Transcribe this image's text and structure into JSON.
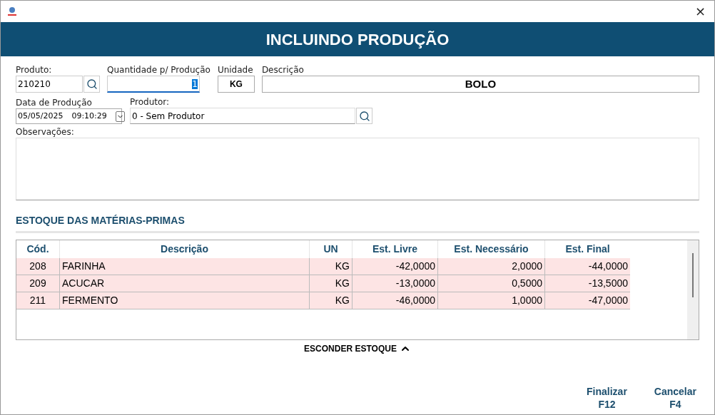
{
  "window": {
    "close": "×"
  },
  "header": {
    "title": "INCLUINDO PRODUÇÃO"
  },
  "form": {
    "produto": {
      "label": "Produto:",
      "value": "210210"
    },
    "quantidade": {
      "label": "Quantidade p/ Produção",
      "value": "1"
    },
    "unidade": {
      "label": "Unidade",
      "value": "KG"
    },
    "descricao": {
      "label": "Descrição",
      "value": "BOLO"
    },
    "data": {
      "label": "Data de Produção",
      "date": "05/05/2025",
      "time": "09:10:29"
    },
    "produtor": {
      "label": "Produtor:",
      "value": "0 - Sem Produtor"
    },
    "observacoes": {
      "label": "Observações:"
    }
  },
  "stock": {
    "title": "ESTOQUE DAS MATÉRIAS-PRIMAS",
    "table": {
      "columns": [
        "Cód.",
        "Descrição",
        "UN",
        "Est. Livre",
        "Est. Necessário",
        "Est. Final"
      ],
      "rows": [
        [
          "208",
          "FARINHA",
          "KG",
          "-42,0000",
          "2,0000",
          "-44,0000"
        ],
        [
          "209",
          "ACUCAR",
          "KG",
          "-13,0000",
          "0,5000",
          "-13,5000"
        ],
        [
          "211",
          "FERMENTO",
          "KG",
          "-46,0000",
          "1,0000",
          "-47,0000"
        ]
      ]
    },
    "toggle": "ESCONDER ESTOQUE"
  },
  "buttons": [
    {
      "label": "Finalizar",
      "key": "F12"
    },
    {
      "label": "Cancelar",
      "key": "F4"
    }
  ]
}
